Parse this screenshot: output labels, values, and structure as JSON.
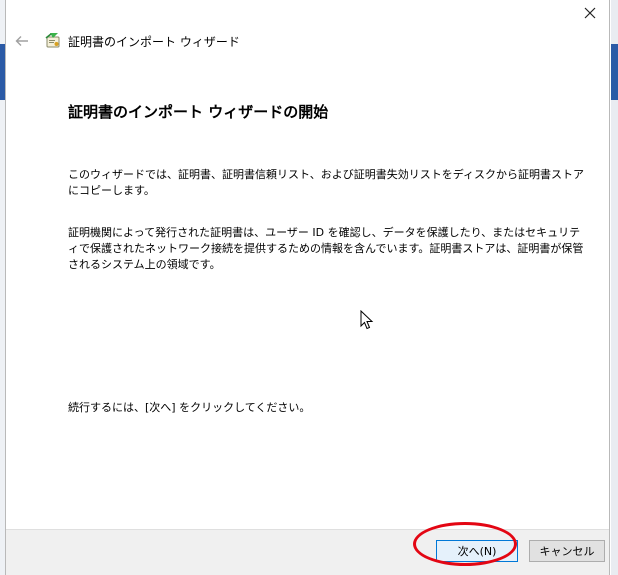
{
  "window": {
    "title": "証明書のインポート ウィザード"
  },
  "content": {
    "heading": "証明書のインポート ウィザードの開始",
    "paragraph1": "このウィザードでは、証明書、証明書信頼リスト、および証明書失効リストをディスクから証明書ストアにコピーします。",
    "paragraph2": "証明機関によって発行された証明書は、ユーザー ID を確認し、データを保護したり、またはセキュリティで保護されたネットワーク接続を提供するための情報を含んでいます。証明書ストアは、証明書が保管されるシステム上の領域です。",
    "paragraph3": "続行するには、[次へ] をクリックしてください。"
  },
  "buttons": {
    "next_label": "次へ(N)",
    "cancel_label": "キャンセル"
  },
  "icons": {
    "close": "close-icon",
    "back": "back-arrow-icon",
    "wizard": "certificate-wizard-icon",
    "cursor": "mouse-pointer-icon"
  },
  "colors": {
    "highlight": "#e30613",
    "accent": "#2b5aa6",
    "default_button_border": "#0078d7"
  }
}
